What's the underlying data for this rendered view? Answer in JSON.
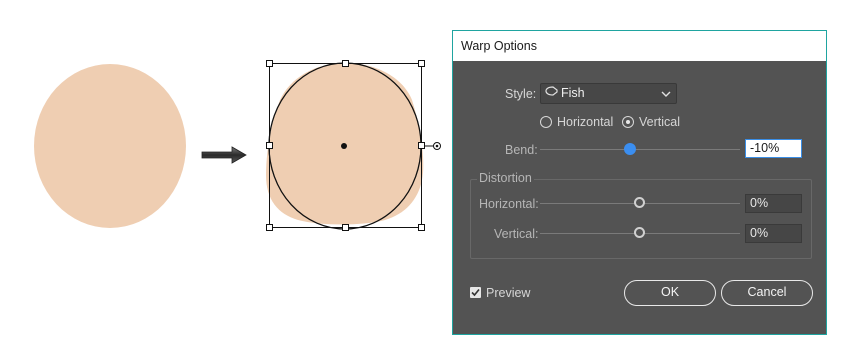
{
  "dialog": {
    "title": "Warp Options",
    "style_label": "Style:",
    "style_value": "Fish",
    "orientation": {
      "horizontal_label": "Horizontal",
      "vertical_label": "Vertical",
      "selected": "vertical"
    },
    "bend_label": "Bend:",
    "bend_value": "-10%",
    "distortion": {
      "group_label": "Distortion",
      "horizontal_label": "Horizontal:",
      "horizontal_value": "0%",
      "vertical_label": "Vertical:",
      "vertical_value": "0%"
    },
    "preview_label": "Preview",
    "preview_checked": true,
    "ok_label": "OK",
    "cancel_label": "Cancel"
  },
  "colors": {
    "shape_fill": "#efceb2",
    "dialog_bg": "#535353",
    "dialog_border": "#1fa4a0",
    "accent": "#3b8ef0"
  },
  "icons": {
    "style_icon": "fish-warp-icon",
    "dropdown_icon": "chevron-down-icon",
    "arrow": "right-arrow-icon"
  }
}
